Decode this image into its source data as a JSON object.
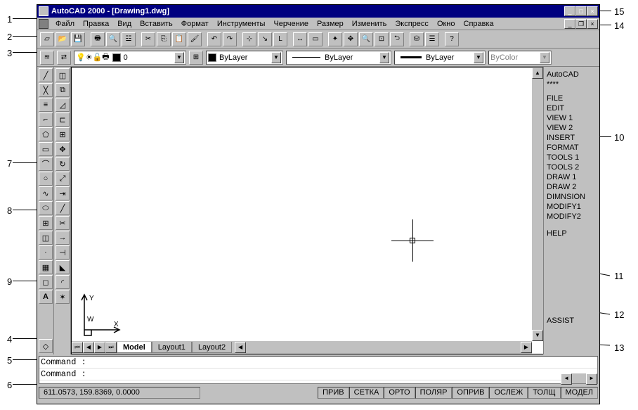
{
  "title": "AutoCAD 2000 - [Drawing1.dwg]",
  "menu": [
    "Файл",
    "Правка",
    "Вид",
    "Вставить",
    "Формат",
    "Инструменты",
    "Черчение",
    "Размер",
    "Изменить",
    "Экспресс",
    "Окно",
    "Справка"
  ],
  "toolbar_icons": [
    "new",
    "open",
    "save",
    "print",
    "preview",
    "find",
    "cut",
    "copy",
    "paste",
    "match",
    "undo",
    "redo",
    "snapfrom",
    "temptrack",
    "ucs",
    "dist",
    "area",
    "redraw",
    "pan",
    "zoom-rt",
    "zoom-win",
    "zoom-prev",
    "db",
    "prop",
    "help"
  ],
  "propbar": {
    "layer_state_icons": [
      "on",
      "freeze",
      "lock",
      "plot"
    ],
    "layer": "0",
    "color": "ByLayer",
    "linetype": "ByLayer",
    "lineweight": "ByLayer",
    "plotstyle": "ByColor"
  },
  "draw_tools": [
    "line",
    "xline",
    "mline",
    "pline",
    "polygon",
    "rect",
    "arc",
    "circle",
    "spline",
    "ellipse",
    "insert",
    "block",
    "point",
    "hatch",
    "region",
    "text"
  ],
  "modify_tools": [
    "erase",
    "copy",
    "mirror",
    "offset",
    "array",
    "move",
    "rotate",
    "scale",
    "stretch",
    "lengthen",
    "trim",
    "extend",
    "break",
    "chamfer",
    "fillet",
    "explode"
  ],
  "side_menu": {
    "head": "AutoCAD",
    "stars": "****",
    "items": [
      "FILE",
      "EDIT",
      "VIEW 1",
      "VIEW 2",
      "INSERT",
      "FORMAT",
      "TOOLS 1",
      "TOOLS 2",
      "DRAW 1",
      "DRAW 2",
      "DIMNSION",
      "MODIFY1",
      "MODIFY2"
    ],
    "help": "HELP",
    "assist": "ASSIST"
  },
  "tabs": {
    "model": "Model",
    "layout1": "Layout1",
    "layout2": "Layout2"
  },
  "command": {
    "line1": "Command :",
    "line2": "Command :"
  },
  "status": {
    "coords": "611.0573, 159.8369, 0.0000",
    "snap": "ПРИВ",
    "grid": "СЕТКА",
    "ortho": "ОРТО",
    "polar": "ПОЛЯР",
    "osnap": "ОПРИВ",
    "otrack": "ОСЛЕЖ",
    "lwt": "ТОЛЩ",
    "model": "МОДЕЛ"
  },
  "callouts": {
    "1": "1",
    "2": "2",
    "3": "3",
    "4": "4",
    "5": "5",
    "6": "6",
    "7": "7",
    "8": "8",
    "9": "9",
    "10": "10",
    "11": "11",
    "12": "12",
    "13": "13",
    "14": "14",
    "15": "15"
  }
}
